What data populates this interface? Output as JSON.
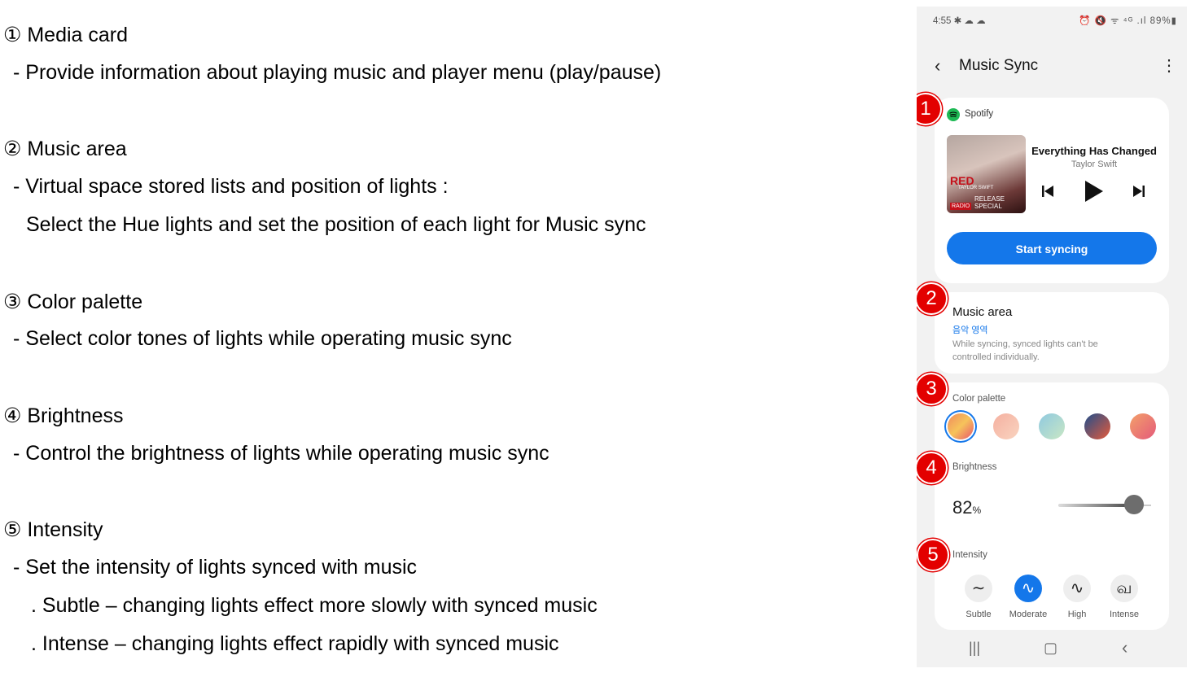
{
  "annotations": {
    "lines": [
      "① Media card",
      "- Provide information about playing music and player menu (play/pause)",
      "② Music area",
      "- Virtual space stored lists and position of lights :",
      "Select the Hue lights and set the position of each light for Music sync",
      "③ Color palette",
      "- Select color tones of lights while operating music sync",
      "④ Brightness",
      "- Control the brightness of lights while operating music sync",
      "⑤ Intensity",
      "- Set the intensity of lights synced with music",
      ". Subtle – changing lights effect more slowly with synced music",
      ". Intense – changing lights effect rapidly with synced music"
    ]
  },
  "phone": {
    "status": {
      "time": "4:55 ✱ ☁ ☁",
      "right": "⏰ 🔇 ᯤ ⁴ᴳ .ıl 89%▮"
    },
    "appbar": {
      "title": "Music Sync",
      "back_icon": "‹",
      "more_icon": "⋮"
    },
    "media": {
      "source": "Spotify",
      "song": "Everything Has Changed",
      "artist": "Taylor Swift",
      "album_text_1": "RED",
      "album_text_2": "TAYLOR SWIFT",
      "album_text_3": "RADIO",
      "album_text_4": "RELEASE SPECIAL",
      "sync_button": "Start syncing"
    },
    "music_area": {
      "title": "Music area",
      "korean": "음악 영역",
      "desc": "While syncing, synced lights can't be controlled individually."
    },
    "palette": {
      "label": "Color palette",
      "selected_index": 0,
      "swatches": [
        "linear-gradient(135deg,#f08a5d,#f6c35b,#e9546b)",
        "linear-gradient(135deg,#f5b0a0,#f9d4c0)",
        "linear-gradient(135deg,#8fc9e0,#c9e7c4)",
        "linear-gradient(135deg,#1f4e8c,#e65a3a)",
        "linear-gradient(135deg,#f3a06a,#e45a7a)"
      ]
    },
    "brightness": {
      "label": "Brightness",
      "value": "82",
      "unit": "%",
      "level": 0.82
    },
    "intensity": {
      "label": "Intensity",
      "selected_index": 1,
      "options": [
        {
          "label": "Subtle",
          "icon": "∼"
        },
        {
          "label": "Moderate",
          "icon": "∿"
        },
        {
          "label": "High",
          "icon": "∿"
        },
        {
          "label": "Intense",
          "icon": "வ"
        }
      ]
    },
    "nav": {
      "recents": "|||",
      "home": "▢",
      "back": "‹"
    },
    "markers": [
      "1",
      "2",
      "3",
      "4",
      "5"
    ]
  }
}
